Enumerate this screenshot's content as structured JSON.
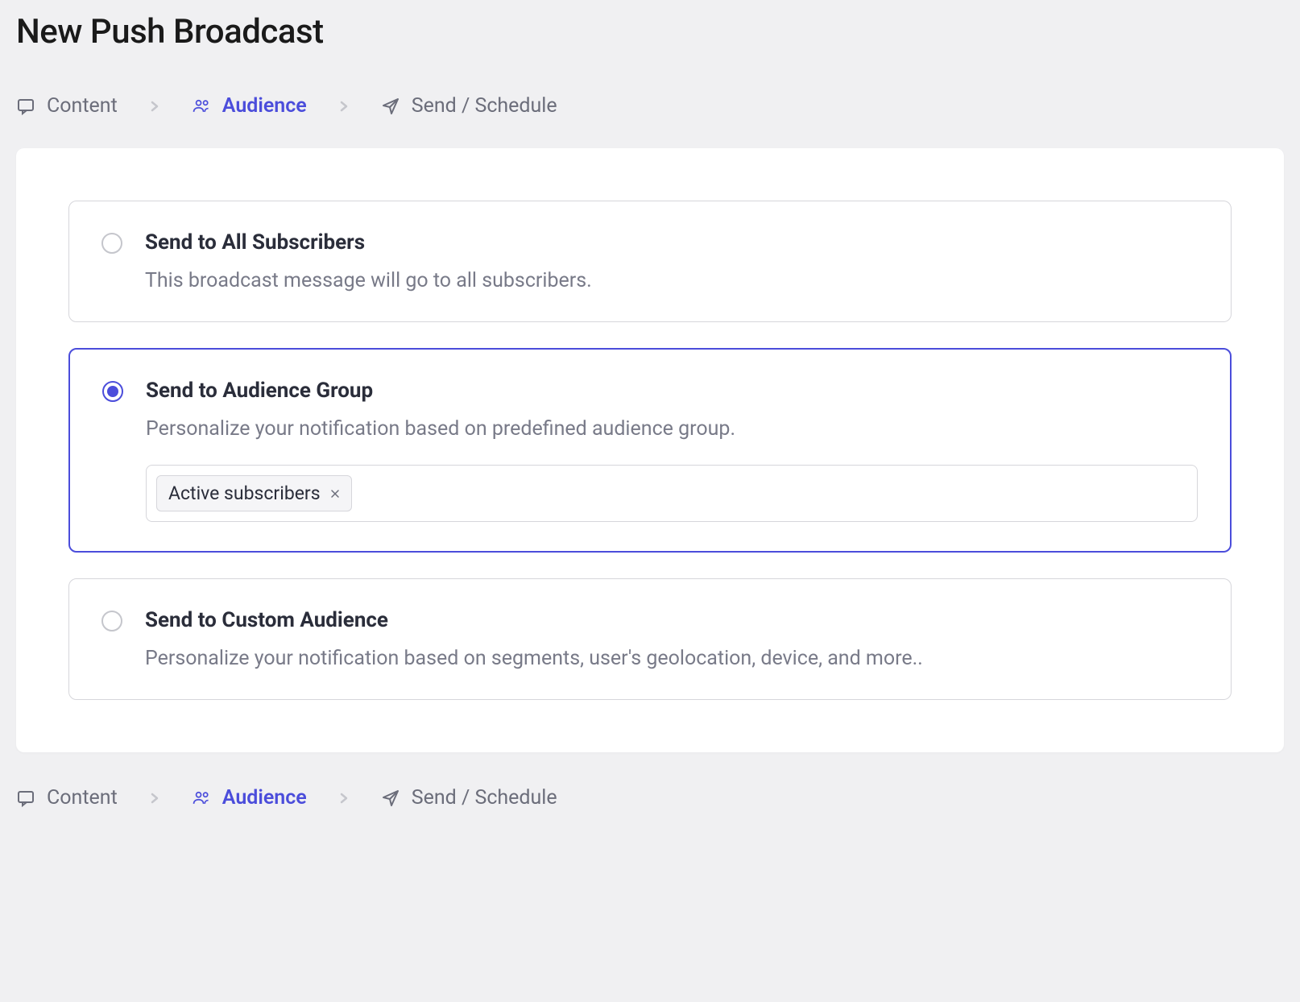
{
  "page": {
    "title": "New Push Broadcast"
  },
  "breadcrumb": {
    "steps": [
      {
        "label": "Content",
        "icon": "message"
      },
      {
        "label": "Audience",
        "icon": "people",
        "active": true
      },
      {
        "label": "Send / Schedule",
        "icon": "send"
      }
    ]
  },
  "options": [
    {
      "title": "Send to All Subscribers",
      "description": "This broadcast message will go to all subscribers.",
      "selected": false
    },
    {
      "title": "Send to Audience Group",
      "description": "Personalize your notification based on predefined audience group.",
      "selected": true,
      "tags": [
        "Active subscribers"
      ]
    },
    {
      "title": "Send to Custom Audience",
      "description": "Personalize your notification based on segments, user's geolocation, device, and more..",
      "selected": false
    }
  ]
}
